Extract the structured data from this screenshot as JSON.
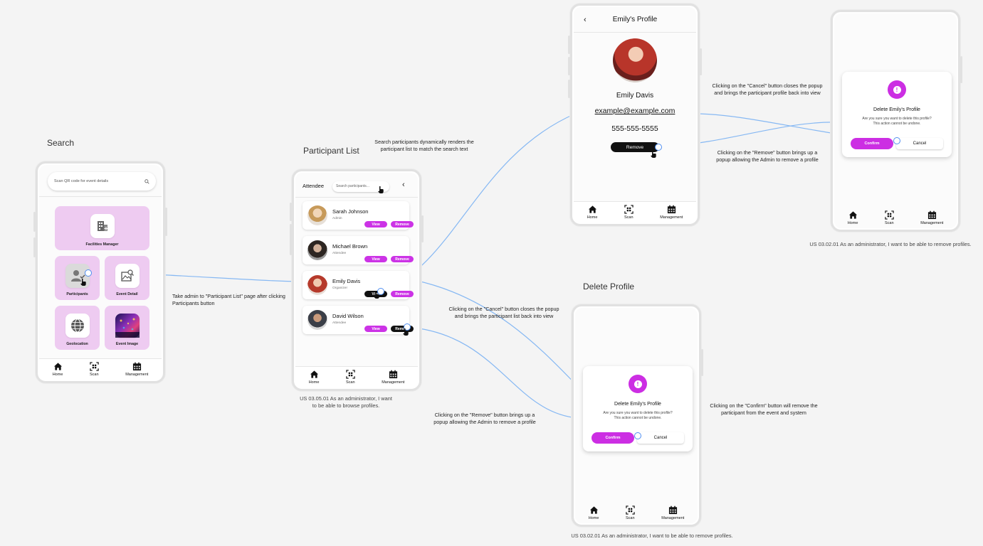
{
  "titles": {
    "search": "Search",
    "participant_list": "Participant List",
    "delete_profile": "Delete Profile"
  },
  "notes": {
    "take_admin": "Take admin to \"Participant List\" page after clicking Participants button",
    "search_dynamic": "Search participants dynamically renders the participant list to match the search text",
    "cancel_profile": "Clicking on the \"Cancel\" button closes the popup and brings the participant profile back into view",
    "remove_profile": "Clicking on the \"Remove\" button brings up a popup allowing the Admin to remove a profile",
    "cancel_list": "Clicking on the \"Cancel\" button closes the popup and brings the participant list back into view",
    "remove_list": "Clicking on the \"Remove\" button brings up a popup allowing the Admin to remove a profile",
    "confirm": "Clicking on the \"Confirm\" button will remove the participant from the event and system"
  },
  "captions": {
    "browse": "US 03.05.01 As an administrator, I want to be able to browse profiles.",
    "remove_top": "US 03.02.01 As an administrator, I want to be able to remove profiles.",
    "remove_bottom": "US 03.02.01 As an administrator, I want to be able to remove profiles."
  },
  "nav": {
    "home": "Home",
    "scan": "Scan",
    "management": "Management"
  },
  "search_screen": {
    "placeholder": "Scan QR code for event details",
    "tiles": {
      "facilities": "Facilities Manager",
      "participants": "Participants",
      "event_detail": "Event Detail",
      "geolocation": "Geolocation",
      "event_image": "Event Image"
    }
  },
  "participant_list": {
    "header": "Attendee",
    "search_placeholder": "Search participants...",
    "view_label": "View",
    "remove_label": "Remove",
    "items": [
      {
        "name": "Sarah Johnson",
        "role": "Admin"
      },
      {
        "name": "Michael Brown",
        "role": "Attendee"
      },
      {
        "name": "Emily Davis",
        "role": "Organizer"
      },
      {
        "name": "David Wilson",
        "role": "Attendee"
      }
    ]
  },
  "profile": {
    "title": "Emily's Profile",
    "name": "Emily Davis",
    "email": "example@example.com",
    "phone": "555-555-5555",
    "remove": "Remove"
  },
  "dialog": {
    "title": "Delete Emily's Profile",
    "line1": "Are you sure you want to delete this profile?",
    "line2": "This action cannot be undone.",
    "confirm": "Confirm",
    "cancel": "Cancel"
  },
  "colors": {
    "accent": "#cc2ee3",
    "tile": "#eecbf1",
    "connector": "#4f8ef0"
  }
}
